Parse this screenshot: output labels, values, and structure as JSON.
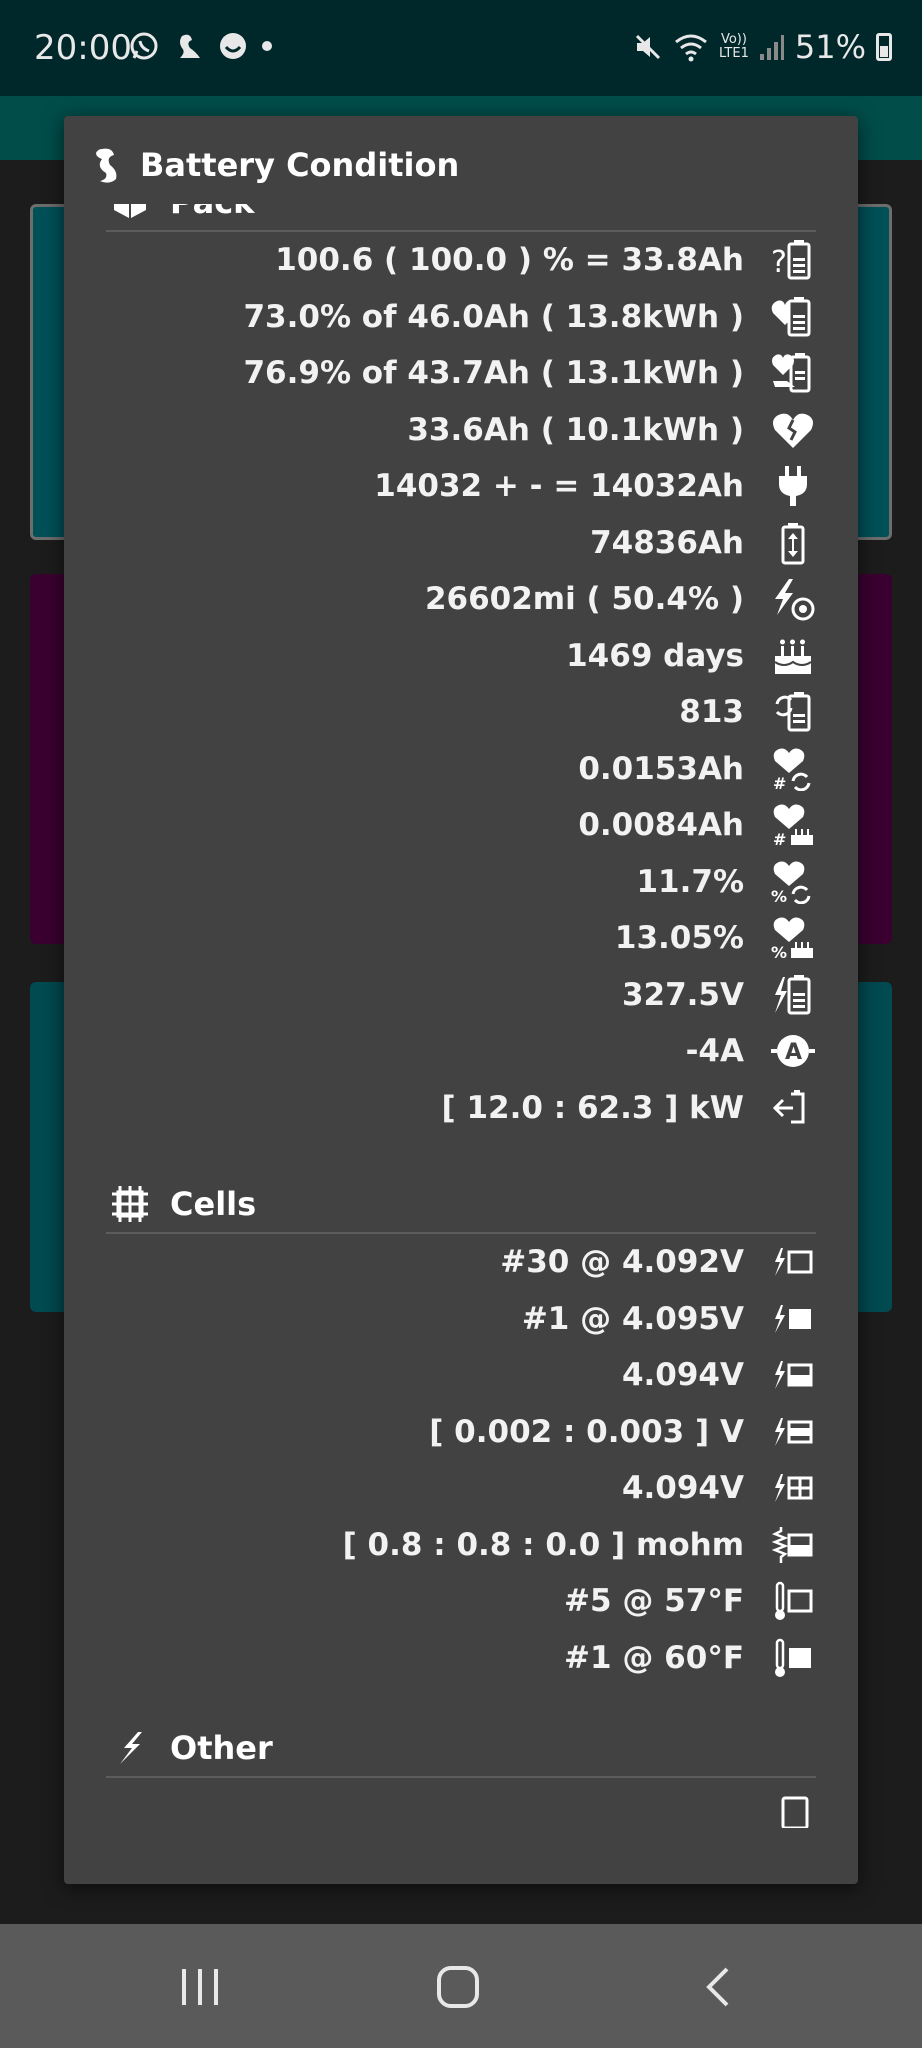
{
  "status_bar": {
    "time": "20:00",
    "network_top": "Vo))",
    "network_bottom": "LTE1",
    "battery_percent": "51%"
  },
  "dialog": {
    "title": "Battery Condition",
    "sections": {
      "pack": {
        "title": "Pack",
        "rows": [
          {
            "value": "100.6 ( 100.0 ) % = 33.8Ah",
            "icon": "battery-question-icon"
          },
          {
            "value": "73.0% of 46.0Ah ( 13.8kWh )",
            "icon": "heart-battery-icon"
          },
          {
            "value": "76.9% of 43.7Ah ( 13.1kWh )",
            "icon": "hand-heart-battery-icon"
          },
          {
            "value": "33.6Ah ( 10.1kWh )",
            "icon": "broken-heart-icon"
          },
          {
            "value": "14032 + - = 14032Ah",
            "icon": "plug-icon"
          },
          {
            "value": "74836Ah",
            "icon": "battery-charge-discharge-icon"
          },
          {
            "value": "26602mi ( 50.4% )",
            "icon": "bolt-wheel-icon"
          },
          {
            "value": "1469 days",
            "icon": "birthday-cake-icon"
          },
          {
            "value": "813",
            "icon": "battery-cycle-icon"
          },
          {
            "value": "0.0153Ah",
            "icon": "heart-hash-cycle-icon"
          },
          {
            "value": "0.0084Ah",
            "icon": "heart-hash-cake-icon"
          },
          {
            "value": "11.7%",
            "icon": "heart-percent-cycle-icon"
          },
          {
            "value": "13.05%",
            "icon": "heart-percent-cake-icon"
          },
          {
            "value": "327.5V",
            "icon": "bolt-battery-icon"
          },
          {
            "value": "-4A",
            "icon": "ampere-circle-icon"
          },
          {
            "value": "[ 12.0 : 62.3 ] kW",
            "icon": "arrow-into-battery-icon"
          }
        ]
      },
      "cells": {
        "title": "Cells",
        "rows": [
          {
            "value": "#30 @ 4.092V",
            "icon": "bolt-cell-empty-icon"
          },
          {
            "value": "#1 @ 4.095V",
            "icon": "bolt-cell-full-icon"
          },
          {
            "value": "4.094V",
            "icon": "bolt-cell-half-icon"
          },
          {
            "value": "[ 0.002 : 0.003 ] V",
            "icon": "bolt-cell-band-icon"
          },
          {
            "value": "4.094V",
            "icon": "bolt-cell-grid-icon"
          },
          {
            "value": "[ 0.8 : 0.8 : 0.0 ] mohm",
            "icon": "resistor-cell-icon"
          },
          {
            "value": "#5 @ 57°F",
            "icon": "thermometer-cell-empty-icon"
          },
          {
            "value": "#1 @ 60°F",
            "icon": "thermometer-cell-full-icon"
          }
        ]
      },
      "other": {
        "title": "Other"
      }
    }
  },
  "colors": {
    "status_bar": "#00282a",
    "dialog_bg": "#424242",
    "divider": "#5c5c5c",
    "nav_bar": "#5a5a5a"
  }
}
